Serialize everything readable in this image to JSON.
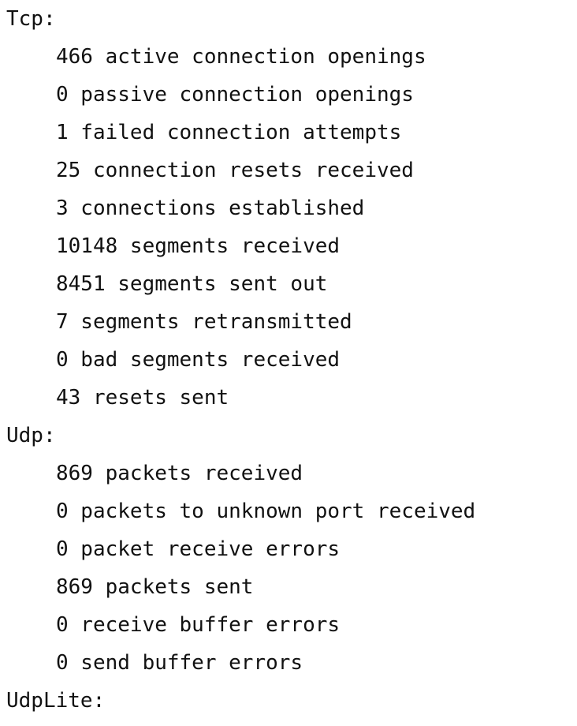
{
  "sections": [
    {
      "header": "Tcp:",
      "lines": [
        "466 active connection openings",
        "0 passive connection openings",
        "1 failed connection attempts",
        "25 connection resets received",
        "3 connections established",
        "10148 segments received",
        "8451 segments sent out",
        "7 segments retransmitted",
        "0 bad segments received",
        "43 resets sent"
      ]
    },
    {
      "header": "Udp:",
      "lines": [
        "869 packets received",
        "0 packets to unknown port received",
        "0 packet receive errors",
        "869 packets sent",
        "0 receive buffer errors",
        "0 send buffer errors"
      ]
    },
    {
      "header": "UdpLite:",
      "lines": []
    }
  ],
  "colors": {
    "background": "#ffffff",
    "text": "#111111"
  }
}
